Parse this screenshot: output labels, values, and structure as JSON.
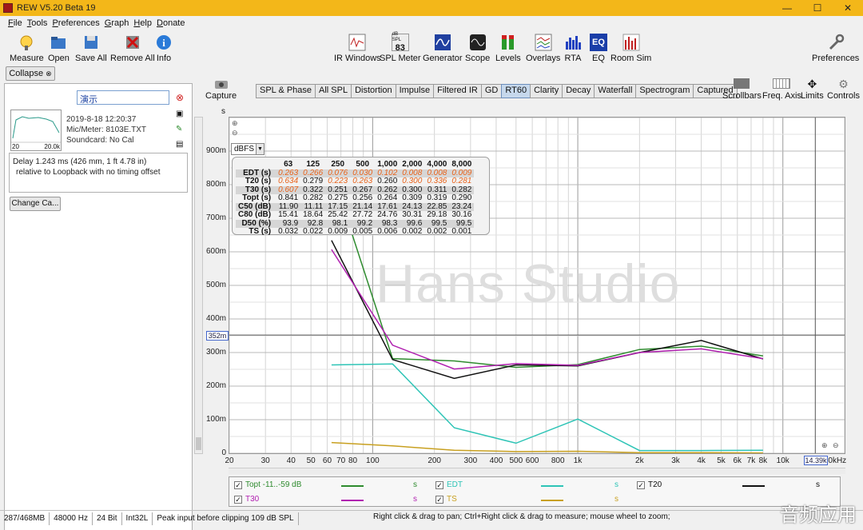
{
  "window": {
    "title": "REW V5.20 Beta 19",
    "min": "—",
    "max": "☐",
    "close": "✕"
  },
  "menu": [
    "File",
    "Tools",
    "Preferences",
    "Graph",
    "Help",
    "Donate"
  ],
  "toolbar_left": [
    {
      "label": "Measure",
      "icon": "measure-icon"
    },
    {
      "label": "Open",
      "icon": "folder-icon"
    },
    {
      "label": "Save All",
      "icon": "save-icon"
    },
    {
      "label": "Remove All",
      "icon": "remove-icon"
    },
    {
      "label": "Info",
      "icon": "info-icon"
    }
  ],
  "toolbar_center": [
    {
      "label": "IR Windows",
      "icon": "ir-windows-icon"
    },
    {
      "label": "SPL Meter",
      "icon": "spl-meter-icon",
      "badge_top": "dB SPL",
      "badge_value": "83"
    },
    {
      "label": "Generator",
      "icon": "generator-icon"
    },
    {
      "label": "Scope",
      "icon": "scope-icon"
    },
    {
      "label": "Levels",
      "icon": "levels-icon"
    },
    {
      "label": "Overlays",
      "icon": "overlays-icon"
    },
    {
      "label": "RTA",
      "icon": "rta-icon"
    },
    {
      "label": "EQ",
      "icon": "eq-icon"
    },
    {
      "label": "Room Sim",
      "icon": "room-sim-icon"
    }
  ],
  "toolbar_right": {
    "label": "Preferences",
    "icon": "wrench-icon"
  },
  "left_panel": {
    "collapse": "Collapse",
    "measurement_name": "演示",
    "date": "2019-8-18 12:20:37",
    "mic": "Mic/Meter: 8103E.TXT",
    "soundcard": "Soundcard: No Cal",
    "thumb_x_min": "20",
    "thumb_x_max": "20.0k",
    "delay_line1": "Delay 1.243 ms (426 mm, 1 ft 4.78 in)",
    "delay_line2": "relative to Loopback with no timing offset",
    "change_cal": "Change Ca..."
  },
  "capture": {
    "label": "Capture"
  },
  "tabs": [
    "SPL & Phase",
    "All SPL",
    "Distortion",
    "Impulse",
    "Filtered IR",
    "GD",
    "RT60",
    "Clarity",
    "Decay",
    "Waterfall",
    "Spectrogram",
    "Captured"
  ],
  "active_tab": "RT60",
  "graph_controls": [
    {
      "label": "Scrollbars",
      "icon": "scrollbars-icon"
    },
    {
      "label": "Freq. Axis",
      "icon": "freq-axis-icon"
    },
    {
      "label": "Limits",
      "icon": "limits-icon"
    },
    {
      "label": "Controls",
      "icon": "controls-icon"
    }
  ],
  "graph": {
    "unit": "s",
    "dropdown": "dBFS",
    "watermark": "Hans Studio",
    "cursor_y": "352m",
    "cursor_x": "14.39k",
    "y_ticks": [
      "900m",
      "800m",
      "700m",
      "600m",
      "500m",
      "400m",
      "300m",
      "200m",
      "100m",
      "0"
    ],
    "x_ticks": [
      "20",
      "30",
      "40",
      "50",
      "60",
      "70",
      "80",
      "100",
      "200",
      "300",
      "400",
      "500",
      "600",
      "800",
      "1k",
      "2k",
      "3k",
      "4k",
      "5k",
      "6k",
      "7k",
      "8k",
      "10k",
      "20kHz"
    ]
  },
  "table": {
    "columns": [
      "63",
      "125",
      "250",
      "500",
      "1,000",
      "2,000",
      "4,000",
      "8,000"
    ],
    "rows": [
      {
        "name": "EDT (s)",
        "values": [
          "0.263",
          "0.266",
          "0.076",
          "0.030",
          "0.102",
          "0.008",
          "0.008",
          "0.009"
        ],
        "orange": [
          true,
          true,
          true,
          true,
          true,
          true,
          true,
          true
        ],
        "shade": true
      },
      {
        "name": "T20 (s)",
        "values": [
          "0.634",
          "0.279",
          "0.223",
          "0.263",
          "0.260",
          "0.300",
          "0.336",
          "0.281"
        ],
        "orange": [
          true,
          false,
          true,
          true,
          false,
          true,
          true,
          true
        ],
        "shade": false
      },
      {
        "name": "T30 (s)",
        "values": [
          "0.607",
          "0.322",
          "0.251",
          "0.267",
          "0.262",
          "0.300",
          "0.311",
          "0.282"
        ],
        "orange": [
          true,
          false,
          false,
          false,
          false,
          false,
          false,
          false
        ],
        "shade": true
      },
      {
        "name": "Topt (s)",
        "values": [
          "0.841",
          "0.282",
          "0.275",
          "0.256",
          "0.264",
          "0.309",
          "0.319",
          "0.290"
        ],
        "orange": [
          false,
          false,
          false,
          false,
          false,
          false,
          false,
          false
        ],
        "shade": false
      },
      {
        "name": "C50 (dB)",
        "values": [
          "11.90",
          "11.11",
          "17.15",
          "21.14",
          "17.61",
          "24.13",
          "22.85",
          "23.24"
        ],
        "orange": [
          false,
          false,
          false,
          false,
          false,
          false,
          false,
          false
        ],
        "shade": true
      },
      {
        "name": "C80 (dB)",
        "values": [
          "15.41",
          "18.64",
          "25.42",
          "27.72",
          "24.76",
          "30.31",
          "29.18",
          "30.16"
        ],
        "orange": [
          false,
          false,
          false,
          false,
          false,
          false,
          false,
          false
        ],
        "shade": false
      },
      {
        "name": "D50 (%)",
        "values": [
          "93.9",
          "92.8",
          "98.1",
          "99.2",
          "98.3",
          "99.6",
          "99.5",
          "99.5"
        ],
        "orange": [
          false,
          false,
          false,
          false,
          false,
          false,
          false,
          false
        ],
        "shade": true
      },
      {
        "name": "TS (s)",
        "values": [
          "0.032",
          "0.022",
          "0.009",
          "0.005",
          "0.006",
          "0.002",
          "0.002",
          "0.001"
        ],
        "orange": [
          false,
          false,
          false,
          false,
          false,
          false,
          false,
          false
        ],
        "shade": false
      }
    ]
  },
  "series": [
    {
      "name": "Topt",
      "legend": "Topt -11..-59 dB",
      "color": "#2e8b2e",
      "unit": "s"
    },
    {
      "name": "EDT",
      "legend": "EDT",
      "color": "#2ec4b6",
      "unit": "s"
    },
    {
      "name": "T20",
      "legend": "T20",
      "color": "#111111",
      "unit": "s"
    },
    {
      "name": "T30",
      "legend": "T30",
      "color": "#b01fb0",
      "unit": "s"
    },
    {
      "name": "TS",
      "legend": "TS",
      "color": "#c8a020",
      "unit": "s"
    }
  ],
  "chart_data": {
    "type": "line",
    "x_scale": "log",
    "xlim": [
      20,
      20000
    ],
    "ylim": [
      0,
      1
    ],
    "x_unit": "Hz",
    "y_unit": "s",
    "series": [
      {
        "name": "Topt",
        "x": [
          63,
          125,
          250,
          500,
          1000,
          2000,
          4000,
          8000
        ],
        "y": [
          0.841,
          0.282,
          0.275,
          0.256,
          0.264,
          0.309,
          0.319,
          0.29
        ]
      },
      {
        "name": "EDT",
        "x": [
          63,
          125,
          250,
          500,
          1000,
          2000,
          4000,
          8000
        ],
        "y": [
          0.263,
          0.266,
          0.076,
          0.03,
          0.102,
          0.008,
          0.008,
          0.009
        ]
      },
      {
        "name": "T20",
        "x": [
          63,
          125,
          250,
          500,
          1000,
          2000,
          4000,
          8000
        ],
        "y": [
          0.634,
          0.279,
          0.223,
          0.263,
          0.26,
          0.3,
          0.336,
          0.281
        ]
      },
      {
        "name": "T30",
        "x": [
          63,
          125,
          250,
          500,
          1000,
          2000,
          4000,
          8000
        ],
        "y": [
          0.607,
          0.322,
          0.251,
          0.267,
          0.262,
          0.3,
          0.311,
          0.282
        ]
      },
      {
        "name": "TS",
        "x": [
          63,
          125,
          250,
          500,
          1000,
          2000,
          4000,
          8000
        ],
        "y": [
          0.032,
          0.022,
          0.009,
          0.005,
          0.006,
          0.002,
          0.002,
          0.001
        ]
      }
    ]
  },
  "status": {
    "memory": "287/468MB",
    "rate": "48000 Hz",
    "bits": "24 Bit",
    "format": "Int32L",
    "peak": "Peak input before clipping 109 dB SPL",
    "hint": "Right click & drag to pan; Ctrl+Right click & drag to measure; mouse wheel to zoom;",
    "corner_watermark": "音频应用"
  }
}
